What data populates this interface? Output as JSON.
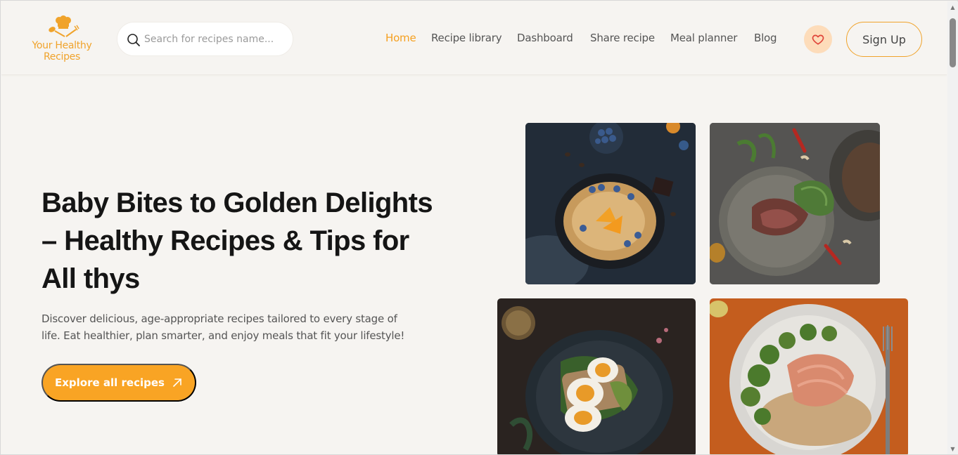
{
  "brand": {
    "line1": "Your Healthy",
    "line2": "Recipes",
    "logo_icon": "chef-hat-icon",
    "color": "#f0a32b"
  },
  "search": {
    "placeholder": "Search for recipes name...",
    "icon": "search-icon"
  },
  "nav": {
    "items": [
      {
        "label": "Home",
        "active": true
      },
      {
        "label": "Recipe library",
        "active": false
      },
      {
        "label": "Dashboard",
        "active": false
      },
      {
        "label": "Share recipe",
        "active": false
      },
      {
        "label": "Meal planner",
        "active": false
      },
      {
        "label": "Blog",
        "active": false
      }
    ],
    "active_color": "#f5a020"
  },
  "header_actions": {
    "favorites_icon": "heart-icon",
    "signup_label": "Sign Up"
  },
  "hero": {
    "title_line1": "Baby Bites to Golden Delights",
    "title_line2": "– Healthy Recipes & Tips for",
    "title_line3": "All thys",
    "description_line1": "Discover delicious, age-appropriate recipes tailored to every stage of",
    "description_line2": "life. Eat healthier, plan smarter, and enjoy meals that fit your lifestyle!",
    "cta_label": "Explore all recipes",
    "cta_icon": "arrow-up-right-icon",
    "cta_color": "#f9a424"
  },
  "gallery": {
    "images": [
      {
        "name": "pancake-blueberry-photo"
      },
      {
        "name": "steak-salad-photo"
      },
      {
        "name": "egg-avocado-toast-photo"
      },
      {
        "name": "salmon-broccoli-photo"
      }
    ]
  }
}
